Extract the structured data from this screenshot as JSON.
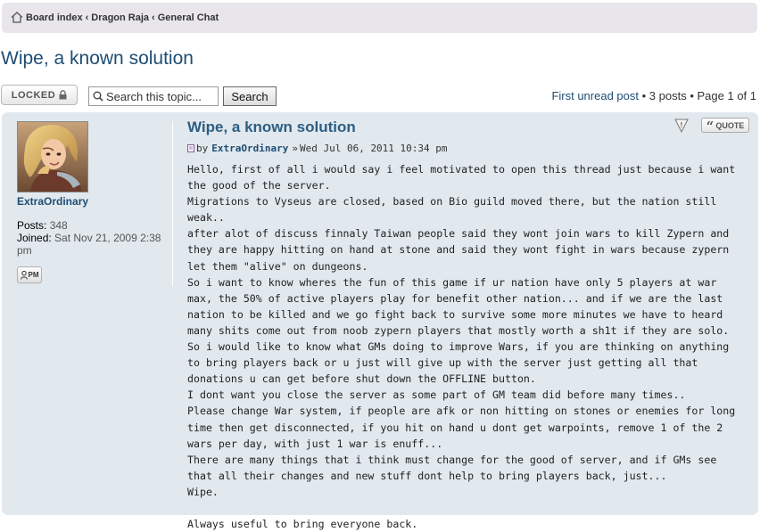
{
  "breadcrumbs": [
    "Board index",
    "Dragon Raja",
    "General Chat"
  ],
  "topic": {
    "title": "Wipe, a known solution"
  },
  "toolbar": {
    "locked_label": "LOCKED",
    "search_placeholder": "Search this topic...",
    "search_button": "Search"
  },
  "pagination": {
    "first_unread": "First unread post",
    "posts_count": "3 posts",
    "page_info": "Page 1 of 1"
  },
  "post": {
    "title": "Wipe, a known solution",
    "by_label": "by",
    "author": "ExtraOrdinary",
    "date": "Wed Jul 06, 2011 10:34 pm",
    "quote_label": "QUOTE",
    "profile": {
      "name": "ExtraOrdinary",
      "posts_label": "Posts:",
      "posts_value": "348",
      "joined_label": "Joined:",
      "joined_value": "Sat Nov 21, 2009 2:38 pm",
      "pm_label": "PM"
    },
    "lines": [
      "Hello, first of all i would say i feel motivated to open this thread just because i want the good of the server.",
      "Migrations to Vyseus are closed, based on Bio guild moved there, but the nation still weak..",
      "after alot of discuss finnaly Taiwan people said they wont join wars to kill Zypern and they are happy hitting on hand at stone and said they wont fight in wars because zypern let them \"alive\" on dungeons.",
      "So i want to know wheres the fun of this game if ur nation have only 5 players at war max, the 50% of active players play for benefit other nation... and if we are the last nation to be killed and we go fight back to survive some more minutes we have to heard many shits come out from noob zypern players that mostly worth a sh1t if they are solo.",
      "So i would like to know what GMs doing to improve Wars, if you are thinking on anything to bring players back or u just will give up with the server just getting all that donations u can get before shut down the OFFLINE button.",
      "I dont want you close the server as some part of GM team did before many times..",
      "Please change War system, if people are afk or non hitting on stones or enemies for long time then get disconnected, if you hit on hand u dont get warpoints, remove 1 of the 2 wars per day, with just 1 war is enuff...",
      "There are many things that i think must change for the good of server, and if GMs see that all their changes and new stuff dont help to bring players back, just...",
      "Wipe.",
      "",
      "Always useful to bring everyone back."
    ]
  },
  "colors": {
    "link": "#1f4d73",
    "post_bg": "#e1e8ee",
    "breadcrumb_bg": "#e8e6ea"
  }
}
